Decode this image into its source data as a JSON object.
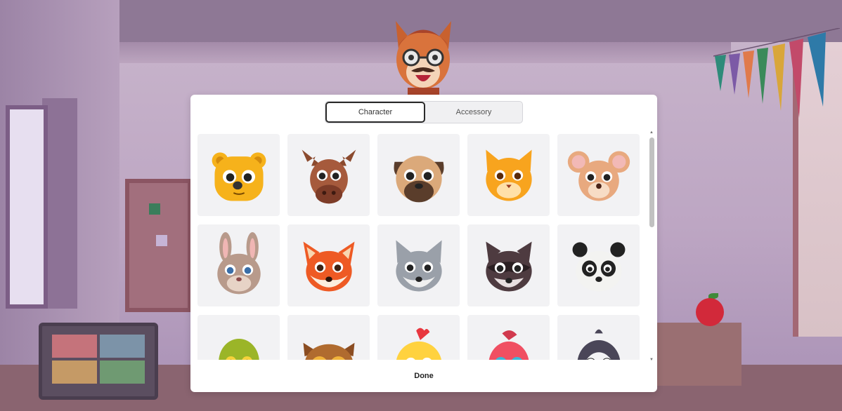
{
  "modal": {
    "tabs": [
      {
        "label": "Character",
        "active": true
      },
      {
        "label": "Accessory",
        "active": false
      }
    ],
    "done_label": "Done"
  },
  "characters": [
    {
      "name": "bear",
      "color": "#f6b21b"
    },
    {
      "name": "moose",
      "color": "#a65a3c"
    },
    {
      "name": "pug",
      "color": "#dba97a"
    },
    {
      "name": "cat",
      "color": "#f8a41e"
    },
    {
      "name": "mouse",
      "color": "#e8a97f"
    },
    {
      "name": "rabbit",
      "color": "#b89a8b"
    },
    {
      "name": "fox",
      "color": "#ee5a24"
    },
    {
      "name": "wolf",
      "color": "#9aa0a9"
    },
    {
      "name": "raccoon",
      "color": "#4e3b40"
    },
    {
      "name": "panda",
      "color": "#f3f3f1"
    },
    {
      "name": "turtle",
      "color": "#9bb528"
    },
    {
      "name": "owl",
      "color": "#b06b2f"
    },
    {
      "name": "chick",
      "color": "#ffd23f"
    },
    {
      "name": "bird",
      "color": "#f04f62"
    },
    {
      "name": "penguin",
      "color": "#4a4658"
    }
  ],
  "colors": {
    "modal_bg": "#ffffff",
    "tile_bg": "#f2f2f4",
    "active_tab_border": "#2b2b2b"
  }
}
